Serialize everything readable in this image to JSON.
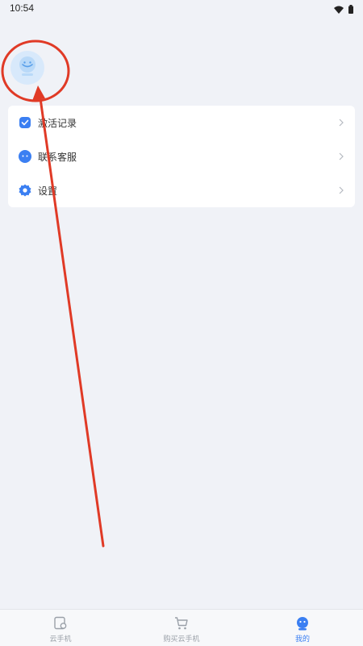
{
  "status_bar": {
    "time": "10:54",
    "icons": [
      "wifi-icon",
      "battery-icon"
    ]
  },
  "profile": {
    "avatar_icon": "avatar-face-icon"
  },
  "menu": {
    "items": [
      {
        "label": "激活记录",
        "icon": "shield-check-icon"
      },
      {
        "label": "联系客服",
        "icon": "chat-bubble-icon"
      },
      {
        "label": "设置",
        "icon": "gear-icon"
      }
    ]
  },
  "bottom_nav": {
    "items": [
      {
        "label": "云手机",
        "icon": "cloud-phone-icon",
        "active": false
      },
      {
        "label": "购买云手机",
        "icon": "cart-icon",
        "active": false
      },
      {
        "label": "我的",
        "icon": "mine-face-icon",
        "active": true
      }
    ]
  },
  "colors": {
    "accent": "#3b7ff2",
    "annotation": "#e03a26",
    "background": "#f0f2f7"
  }
}
